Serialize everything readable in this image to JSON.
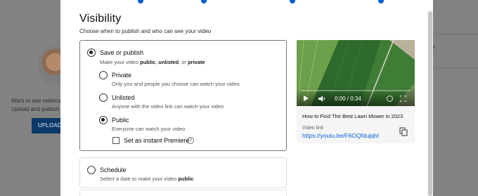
{
  "dialog": {
    "title": "Visibility",
    "subtitle": "Choose when to publish and who can see your video"
  },
  "save_or_publish": {
    "label": "Save or publish",
    "desc_prefix": "Make your video ",
    "desc_public": "public",
    "desc_sep": ", ",
    "desc_unlisted": "unlisted",
    "desc_or": ", or ",
    "desc_private": "private",
    "options": [
      {
        "label": "Private",
        "desc": "Only you and people you choose can watch your video",
        "selected": false
      },
      {
        "label": "Unlisted",
        "desc": "Anyone with the video link can watch your video",
        "selected": false
      },
      {
        "label": "Public",
        "desc": "Everyone can watch your video",
        "selected": true
      }
    ],
    "premiere_label": "Set as instant Premiere",
    "premiere_help": "?"
  },
  "schedule": {
    "label": "Schedule",
    "desc_prefix": "Select a date to make your video ",
    "desc_public": "public"
  },
  "video": {
    "time": "0:00 / 0:34",
    "title": "How to Find The Best Lawn Mower in 2023",
    "link_label": "Video link",
    "link": "https://youtu.be/F6OQfdujqhI"
  },
  "background": {
    "metrics_text": "Want to see metrics c",
    "upload_text": "Upload and publish a",
    "upload_button": "UPLOAD",
    "right_text": "p"
  },
  "colors": {
    "accent": "#065fd4",
    "overlay": "#7f7f7f"
  }
}
